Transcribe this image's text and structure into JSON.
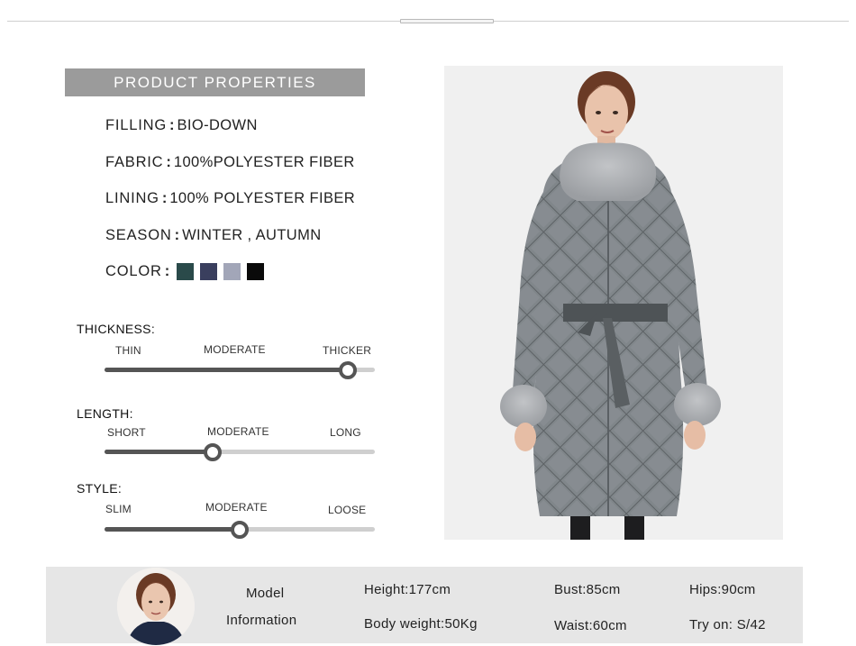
{
  "banner": {
    "title": "PRODUCT PROPERTIES"
  },
  "properties": [
    {
      "key": "FILLING",
      "value": "BIO-DOWN"
    },
    {
      "key": "FABRIC",
      "value": "100%POLYESTER FIBER"
    },
    {
      "key": "LINING",
      "value": "100% POLYESTER FIBER"
    },
    {
      "key": "SEASON",
      "value": "WINTER , AUTUMN"
    }
  ],
  "color_row": {
    "key": "COLOR",
    "swatches": [
      "#2a4a4a",
      "#3a3f5e",
      "#a2a6b8",
      "#0a0a0a"
    ]
  },
  "scales": [
    {
      "title": "THICKNESS:",
      "labels": [
        "THIN",
        "MODERATE",
        "THICKER"
      ],
      "level": 0.9
    },
    {
      "title": "LENGTH:",
      "labels": [
        "SHORT",
        "MODERATE",
        "LONG"
      ],
      "level": 0.4
    },
    {
      "title": "STYLE:",
      "labels": [
        "SLIM",
        "MODERATE",
        "LOOSE"
      ],
      "level": 0.5
    }
  ],
  "model": {
    "label_line1": "Model",
    "label_line2": "Information",
    "height": "Height:177cm",
    "body_weight": "Body weight:50Kg",
    "bust": "Bust:85cm",
    "waist": "Waist:60cm",
    "hips": "Hips:90cm",
    "try_on": "Try on:  S/42"
  },
  "colors": {
    "banner": "#9b9b9b",
    "track": "#cfcfcf",
    "track_fill": "#555555",
    "coat": "#7f8588",
    "fur": "#a9acaf"
  }
}
